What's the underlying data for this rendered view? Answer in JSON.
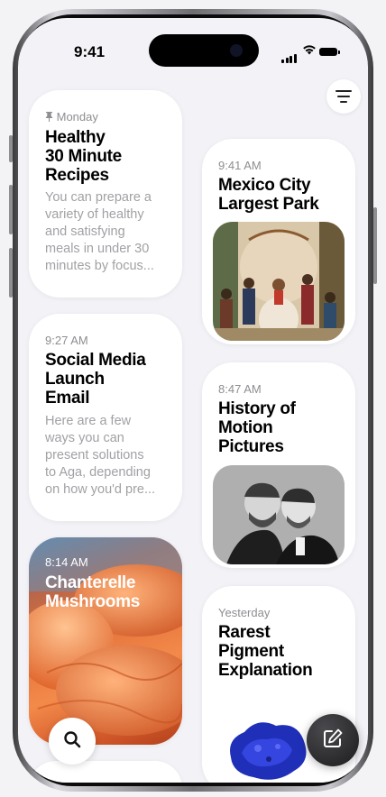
{
  "status_bar": {
    "time": "9:41"
  },
  "notes": [
    {
      "meta": "Monday",
      "pinned": true,
      "title_lines": [
        "Healthy",
        "30 Minute",
        "Recipes"
      ],
      "body_lines": [
        "You can prepare a",
        "variety of healthy",
        "and satisfying",
        "meals in under 30",
        "minutes by focus..."
      ]
    },
    {
      "meta": "9:27 AM",
      "title_lines": [
        "Social Media",
        "Launch",
        "Email"
      ],
      "body_lines": [
        "Here are a few",
        "ways you can",
        "present solutions",
        "to Aga, depending",
        "on how you'd pre..."
      ]
    },
    {
      "meta": "8:14 AM",
      "title_lines": [
        "Chanterelle",
        "Mushrooms"
      ]
    },
    {
      "meta": "9:41 AM",
      "title_lines": [
        "Mexico City",
        "Largest Park"
      ]
    },
    {
      "meta": "8:47 AM",
      "title_lines": [
        "History of",
        "Motion",
        "Pictures"
      ]
    },
    {
      "meta": "Yesterday",
      "title_lines": [
        "Rarest",
        "Pigment",
        "Explanation"
      ]
    }
  ],
  "icons": {
    "menu": "menu-lines-icon",
    "search": "search-icon",
    "compose": "compose-icon",
    "pin": "pin-icon"
  }
}
